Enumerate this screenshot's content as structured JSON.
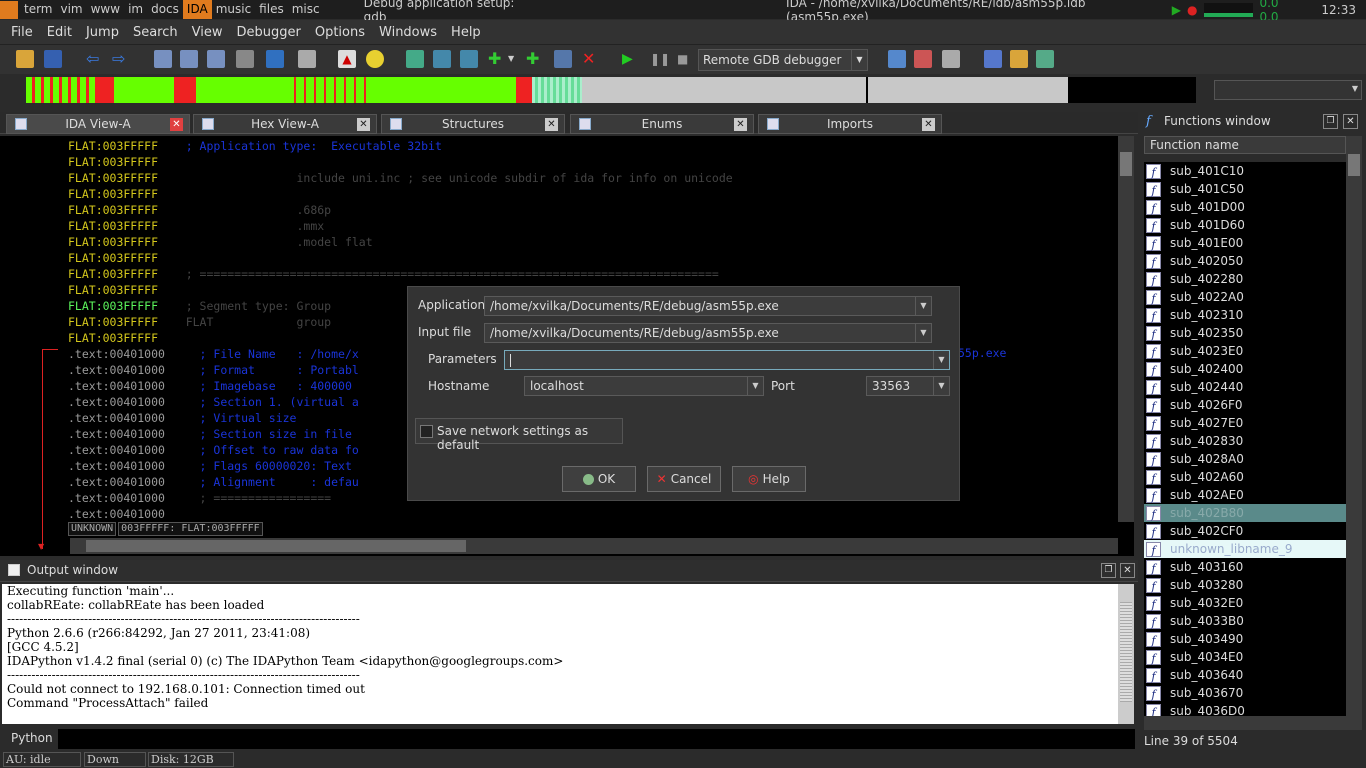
{
  "topbar": {
    "tags": [
      "term",
      "vim",
      "www",
      "im",
      "docs",
      "IDA",
      "music",
      "files",
      "misc"
    ],
    "active_tag": "IDA",
    "window1_title": "Debug application setup: gdb",
    "window2_title": "IDA - /home/xvilka/Documents/RE/idb/asm55p.idb (asm55p.exe)",
    "load": "0.0  0.0",
    "clock": "12:33"
  },
  "menu": [
    "File",
    "Edit",
    "Jump",
    "Search",
    "View",
    "Debugger",
    "Options",
    "Windows",
    "Help"
  ],
  "toolbar": {
    "debugger_select": "Remote GDB debugger"
  },
  "tabs": [
    {
      "label": "IDA View-A",
      "active": true
    },
    {
      "label": "Hex View-A",
      "active": false
    },
    {
      "label": "Structures",
      "active": false
    },
    {
      "label": "Enums",
      "active": false
    },
    {
      "label": "Imports",
      "active": false
    }
  ],
  "listing": [
    {
      "addr": "FLAT:003FFFFF",
      "text": "    ; Application type:  Executable 32bit",
      "kind": "cmt"
    },
    {
      "addr": "FLAT:003FFFFF",
      "text": "",
      "kind": "cmt"
    },
    {
      "addr": "FLAT:003FFFFF",
      "text": "                    include uni.inc ; see unicode subdir of ida for info on unicode",
      "kind": "dir"
    },
    {
      "addr": "FLAT:003FFFFF",
      "text": "",
      "kind": "dir"
    },
    {
      "addr": "FLAT:003FFFFF",
      "text": "                    .686p",
      "kind": "dir"
    },
    {
      "addr": "FLAT:003FFFFF",
      "text": "                    .mmx",
      "kind": "dir"
    },
    {
      "addr": "FLAT:003FFFFF",
      "text": "                    .model flat",
      "kind": "dir"
    },
    {
      "addr": "FLAT:003FFFFF",
      "text": "",
      "kind": "dir"
    },
    {
      "addr": "FLAT:003FFFFF",
      "text": "    ; ===========================================================================",
      "kind": "dir"
    },
    {
      "addr": "FLAT:003FFFFF",
      "text": "",
      "kind": "dir"
    },
    {
      "addr": "FLAT:003FFFFF",
      "text": "    ; Segment type: Group",
      "kind": "dir"
    },
    {
      "addr": "FLAT:003FFFFF",
      "text": "    FLAT            group",
      "kind": "dir"
    },
    {
      "addr": "FLAT:003FFFFF",
      "text": "",
      "kind": "dir"
    },
    {
      "addr": ".text:00401000",
      "text": "     ; File Name   : /home/x",
      "kind": "cmt"
    },
    {
      "addr": ".text:00401000",
      "text": "     ; Format      : Portabl",
      "kind": "cmt"
    },
    {
      "addr": ".text:00401000",
      "text": "     ; Imagebase   : 400000",
      "kind": "cmt"
    },
    {
      "addr": ".text:00401000",
      "text": "     ; Section 1. (virtual a",
      "kind": "cmt"
    },
    {
      "addr": ".text:00401000",
      "text": "     ; Virtual size",
      "kind": "cmt"
    },
    {
      "addr": ".text:00401000",
      "text": "     ; Section size in file",
      "kind": "cmt"
    },
    {
      "addr": ".text:00401000",
      "text": "     ; Offset to raw data fo",
      "kind": "cmt"
    },
    {
      "addr": ".text:00401000",
      "text": "     ; Flags 60000020: Text",
      "kind": "cmt"
    },
    {
      "addr": ".text:00401000",
      "text": "     ; Alignment     : defau",
      "kind": "cmt"
    },
    {
      "addr": ".text:00401000",
      "text": "     ; =================",
      "kind": "dir"
    },
    {
      "addr": ".text:00401000",
      "text": "",
      "kind": "dir"
    }
  ],
  "listing_overflow": "55p.exe",
  "view_status": {
    "mode": "UNKNOWN",
    "location": "003FFFFF: FLAT:003FFFFF"
  },
  "dialog": {
    "application_label": "Application",
    "application_value": "/home/xvilka/Documents/RE/debug/asm55p.exe",
    "input_file_label": "Input file",
    "input_file_value": "/home/xvilka/Documents/RE/debug/asm55p.exe",
    "parameters_label": "Parameters",
    "parameters_value": "",
    "hostname_label": "Hostname",
    "hostname_value": "localhost",
    "port_label": "Port",
    "port_value": "33563",
    "save_checkbox_label": "Save network settings as default",
    "ok": "OK",
    "cancel": "Cancel",
    "help": "Help"
  },
  "output": {
    "title": "Output window",
    "lines": [
      "Executing function 'main'...",
      "collabREate: collabREate has been loaded",
      "---------------------------------------------------------------------------------------",
      "Python 2.6.6 (r266:84292, Jan 27 2011, 23:41:08)",
      "[GCC 4.5.2]",
      "IDAPython v1.4.2 final (serial 0) (c) The IDAPython Team <idapython@googlegroups.com>",
      "---------------------------------------------------------------------------------------",
      "Could not connect to 192.168.0.101: Connection timed out",
      "Command \"ProcessAttach\" failed"
    ],
    "input_label": "Python"
  },
  "status": {
    "au": "AU:  idle",
    "dir": "Down",
    "disk": "Disk: 12GB"
  },
  "functions": {
    "title": "Functions window",
    "column": "Function name",
    "items": [
      "sub_401C10",
      "sub_401C50",
      "sub_401D00",
      "sub_401D60",
      "sub_401E00",
      "sub_402050",
      "sub_402280",
      "sub_4022A0",
      "sub_402310",
      "sub_402350",
      "sub_4023E0",
      "sub_402400",
      "sub_402440",
      "sub_4026F0",
      "sub_4027E0",
      "sub_402830",
      "sub_4028A0",
      "sub_402A60",
      "sub_402AE0",
      "sub_402B80",
      "sub_402CF0",
      "unknown_libname_9",
      "sub_403160",
      "sub_403280",
      "sub_4032E0",
      "sub_4033B0",
      "sub_403490",
      "sub_4034E0",
      "sub_403640",
      "sub_403670",
      "sub_4036D0"
    ],
    "selected": "sub_402B80",
    "highlighted": "unknown_libname_9",
    "line_status": "Line 39 of 5504"
  }
}
